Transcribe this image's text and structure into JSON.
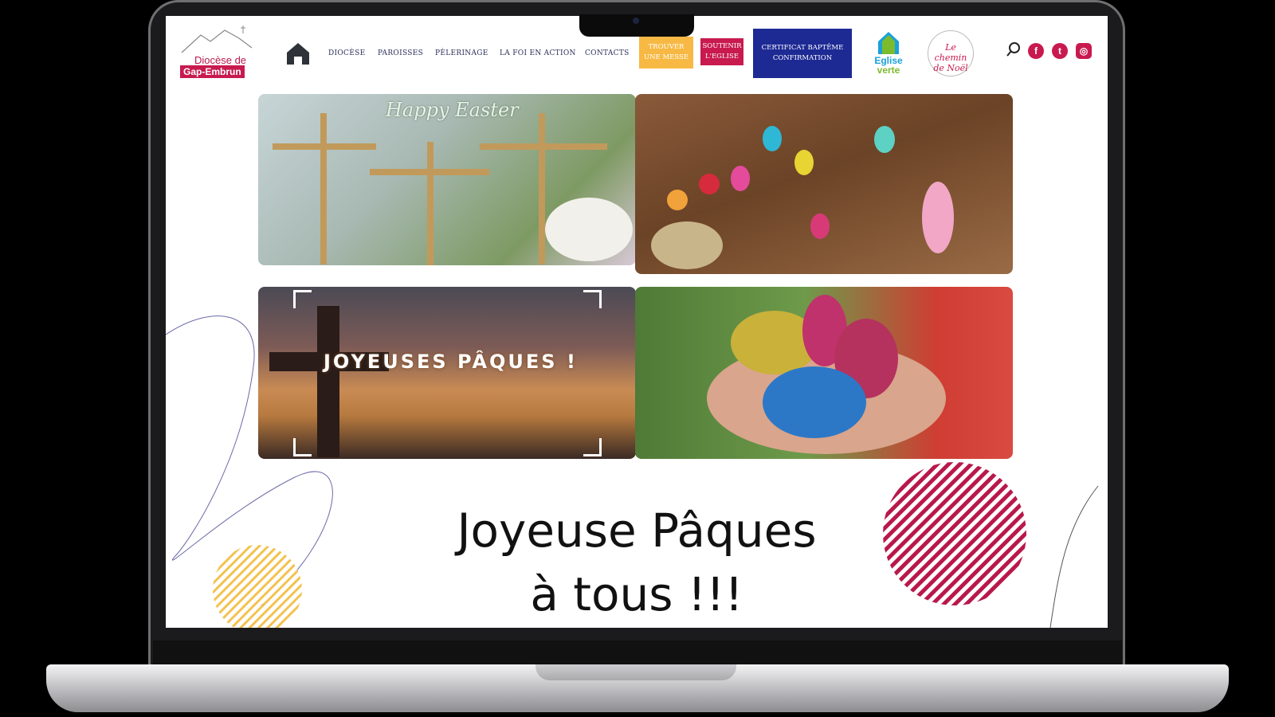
{
  "header": {
    "logo": {
      "line1": "Diocèse de",
      "line2": "Gap-Embrun"
    },
    "nav": [
      "DIOCÈSE",
      "PAROISSES",
      "PÈLERINAGE",
      "LA FOI EN ACTION",
      "CONTACTS"
    ],
    "buttons": {
      "find_mass": "TROUVER UNE MESSE",
      "support": "SOUTENIR L'EGLISE",
      "certificate": "CERTIFICAT BAPTÊME CONFIRMATION"
    },
    "partner_logos": {
      "eglise_verte_1": "Eglise",
      "eglise_verte_2": "verte",
      "noel": "Le chemin de Noël"
    },
    "icons": [
      "home-icon",
      "search-icon",
      "facebook-icon",
      "twitter-icon",
      "instagram-icon"
    ]
  },
  "tiles": {
    "happy_easter": "Happy Easter",
    "joyeuses": "JOYEUSES PÂQUES !"
  },
  "main": {
    "title_line1": "Joyeuse Pâques",
    "title_line2": "à tous !!!"
  },
  "colors": {
    "brand_red": "#c81a4f",
    "brand_yellow": "#f7b944",
    "brand_blue": "#1e2a94"
  }
}
